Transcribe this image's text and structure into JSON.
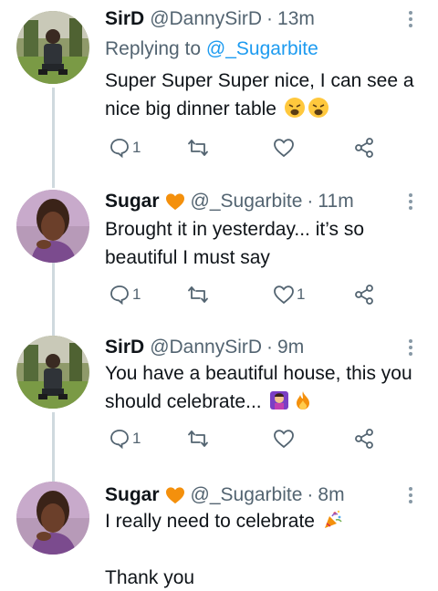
{
  "tweets": [
    {
      "name": "SirD",
      "handle": "@DannySirD",
      "time": "13m",
      "reply_prefix": "Replying to",
      "reply_mention": "@_Sugarbite",
      "lines": [
        "Super Super Super nice, I can see a",
        "nice big dinner table"
      ],
      "line_emojis": [
        "weary-face-emoji",
        "weary-face-emoji"
      ],
      "reply_count": "1",
      "like_count": ""
    },
    {
      "name": "Sugar",
      "name_emoji": "orange-heart-emoji",
      "handle": "@_Sugarbite",
      "time": "11m",
      "lines": [
        "Brought it in yesterday... it’s so",
        "beautiful I must say"
      ],
      "reply_count": "1",
      "like_count": "1"
    },
    {
      "name": "SirD",
      "handle": "@DannySirD",
      "time": "9m",
      "lines": [
        "You have a beautiful house, this you",
        "should celebrate..."
      ],
      "line_emojis": [
        "woman-raising-hands-emoji",
        "fire-emoji"
      ],
      "reply_count": "1",
      "like_count": ""
    },
    {
      "name": "Sugar",
      "name_emoji": "orange-heart-emoji",
      "handle": "@_Sugarbite",
      "time": "8m",
      "lines": [
        "I really need to celebrate",
        "",
        "Thank you"
      ],
      "line_emojis": [
        "party-popper-emoji"
      ]
    }
  ],
  "separator": "·",
  "icons": [
    "more-icon",
    "reply-icon",
    "retweet-icon",
    "like-icon",
    "share-icon"
  ],
  "colors": {
    "text": "#0f1419",
    "secondary": "#536471",
    "link": "#1d9bf0",
    "thread": "#cfd9de"
  }
}
